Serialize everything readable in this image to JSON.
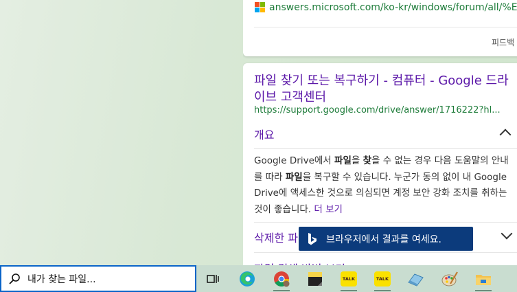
{
  "result1": {
    "url": "answers.microsoft.com/ko-kr/windows/forum/all/%EC...",
    "feedback": "피드백"
  },
  "result2": {
    "title": "파일 찾기 또는 복구하기 - 컴퓨터 - Google 드라이브 고객센터",
    "url": "https://support.google.com/drive/answer/1716222?hl...",
    "section_overview": "개요",
    "body_parts": [
      "Google Drive에서 ",
      "파일",
      "을 ",
      "찾",
      "을 수 없는 경우 다음 도움말의 안내를 따라 ",
      "파일",
      "을 복구할 수 있습니다. 누군가 동의 없이 내 Google Drive에 액세스한 것으로 의심되면 계정 보안 강화 조치를 취하는 것이 좋습니다. "
    ],
    "more_link": "더 보기",
    "section_deleted": "삭제한 파",
    "section_third": "파일 검색 방법 보기"
  },
  "toast": {
    "label": "브라우저에서 결과를 여세요."
  },
  "taskbar": {
    "search_text": "내가 찾는 파일...",
    "kakao_label": "TALK"
  },
  "colors": {
    "accent": "#0a64c8",
    "link": "#5b17a8",
    "url": "#1e7c3a",
    "toast_bg": "#0c3b7c"
  }
}
